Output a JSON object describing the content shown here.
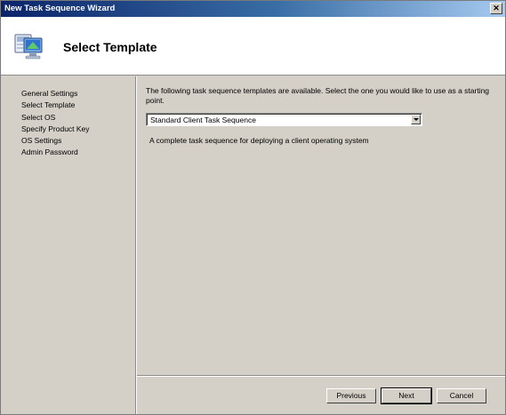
{
  "window": {
    "title": "New Task Sequence Wizard",
    "close_glyph": "✕"
  },
  "header": {
    "title": "Select Template",
    "icon": "computer-icon"
  },
  "nav": {
    "items": [
      {
        "label": "General Settings"
      },
      {
        "label": "Select Template"
      },
      {
        "label": "Select OS"
      },
      {
        "label": "Specify Product Key"
      },
      {
        "label": "OS Settings"
      },
      {
        "label": "Admin Password"
      }
    ]
  },
  "content": {
    "intro": "The following task sequence templates are available.  Select the one you would like to use as a starting point.",
    "template_select": {
      "value": "Standard Client Task Sequence"
    },
    "description": "A complete task sequence for deploying a client operating system"
  },
  "buttons": {
    "previous": "Previous",
    "next": "Next",
    "cancel": "Cancel"
  }
}
